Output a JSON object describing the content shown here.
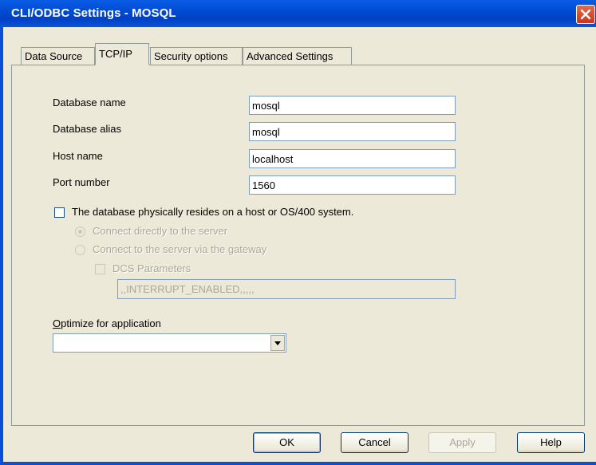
{
  "window": {
    "title": "CLI/ODBC Settings - MOSQL"
  },
  "tabs": [
    {
      "label": "Data Source",
      "active": false
    },
    {
      "label": "TCP/IP",
      "active": true
    },
    {
      "label": "Security options",
      "active": false
    },
    {
      "label": "Advanced Settings",
      "active": false
    }
  ],
  "form": {
    "database_name": {
      "label": "Database name",
      "value": "mosql"
    },
    "database_alias": {
      "label": "Database alias",
      "value": "mosql"
    },
    "host_name": {
      "label": "Host name",
      "value": "localhost"
    },
    "port_number": {
      "label": "Port number",
      "value": "1560"
    },
    "host_system_checkbox": {
      "label": "The database physically resides on a host or OS/400 system.",
      "checked": false
    },
    "connect_direct": {
      "label": "Connect directly to the server",
      "selected": true,
      "enabled": false
    },
    "connect_gateway": {
      "label": "Connect to the server via the gateway",
      "selected": false,
      "enabled": false
    },
    "dcs_parameters": {
      "label": "DCS Parameters",
      "checked": false,
      "enabled": false
    },
    "dcs_value": ",,INTERRUPT_ENABLED,,,,,",
    "optimize_label": "Optimize for application",
    "optimize_value": ""
  },
  "buttons": {
    "ok": "OK",
    "cancel": "Cancel",
    "apply": "Apply",
    "help": "Help"
  },
  "colors": {
    "titlebar": "#0049d0",
    "dialog_bg": "#ece9d8",
    "close_button": "#d4462a",
    "disabled_text": "#aca899"
  }
}
